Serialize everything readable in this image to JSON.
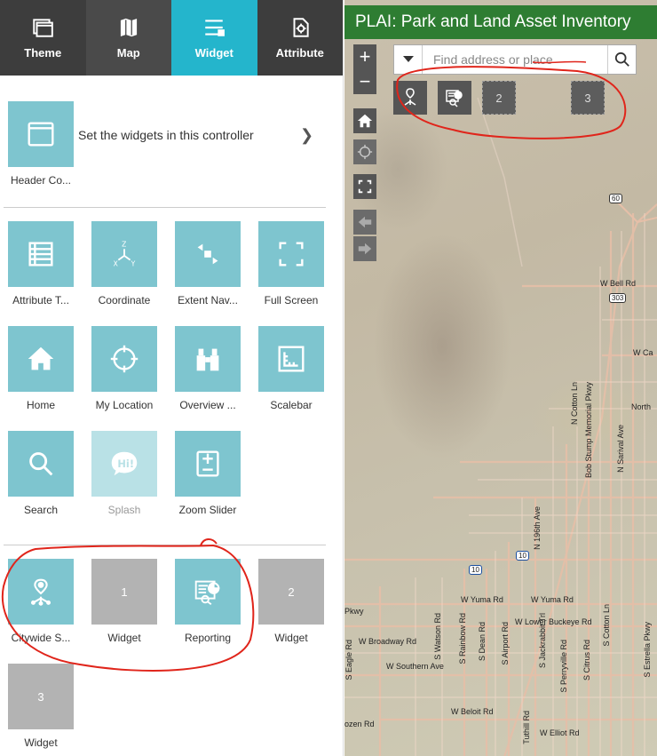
{
  "tabs": [
    {
      "label": "Theme",
      "icon": "theme-icon"
    },
    {
      "label": "Map",
      "icon": "map-icon"
    },
    {
      "label": "Widget",
      "icon": "widget-icon",
      "active": true
    },
    {
      "label": "Attribute",
      "icon": "attribute-icon"
    }
  ],
  "header_controller": {
    "label": "Header Co...",
    "description": "Set the widgets in this controller",
    "icon": "header-window-icon"
  },
  "widgets": [
    {
      "label": "Attribute T...",
      "icon": "table-icon"
    },
    {
      "label": "Coordinate",
      "icon": "xyz-axes-icon"
    },
    {
      "label": "Extent Nav...",
      "icon": "extent-arrows-icon"
    },
    {
      "label": "Full Screen",
      "icon": "fullscreen-icon"
    },
    {
      "label": "Home",
      "icon": "home-icon"
    },
    {
      "label": "My Location",
      "icon": "crosshair-icon"
    },
    {
      "label": "Overview ...",
      "icon": "binoculars-icon"
    },
    {
      "label": "Scalebar",
      "icon": "scalebar-icon"
    },
    {
      "label": "Search",
      "icon": "magnifier-icon"
    },
    {
      "label": "Splash",
      "icon": "hi-bubble-icon",
      "faded": true
    },
    {
      "label": "Zoom Slider",
      "icon": "zoom-slider-icon"
    }
  ],
  "placeholder_widgets": [
    {
      "label": "Citywide S...",
      "icon": "network-pin-icon"
    },
    {
      "label": "Widget",
      "number": "1"
    },
    {
      "label": "Reporting",
      "icon": "report-icon"
    },
    {
      "label": "Widget",
      "number": "2"
    },
    {
      "label": "Widget",
      "number": "3"
    }
  ],
  "map": {
    "title": "PLAI: Park and Land Asset Inventory",
    "search_placeholder": "Find address or place",
    "zoom_in": "+",
    "zoom_out": "−",
    "onmap_placeholders": [
      "2",
      "3"
    ],
    "labels": {
      "bell": "W Bell Rd",
      "ca": "W Ca",
      "north": "North",
      "yuma1": "W Yuma Rd",
      "yuma2": "W Yuma Rd",
      "lower_buckeye": "W Lower Buckeye Rd",
      "broadway": "W Broadway Rd",
      "southern": "W Southern Ave",
      "beloit": "W Beloit Rd",
      "elliot": "W Elliot Rd",
      "pkwy": "Pkwy",
      "ozen": "ozen Rd",
      "cotton": "N Cotton Ln",
      "bob_stump": "Bob Stump Memorial Pkwy",
      "sarival": "N Sarival Ave",
      "n_196th": "N 196th Ave",
      "cotton_s": "S Cotton Ln",
      "estrella": "S Estrella Pkwy",
      "watson": "S Watson Rd",
      "dean": "S Dean Rd",
      "airport": "S Airport Rd",
      "rainbow": "S Rainbow Rd",
      "jackrabbit": "S Jackrabbit Trl",
      "perryville": "S Perryville Rd",
      "citrus": "S Citrus Rd",
      "tuthill": "Tuthill Rd",
      "eagle": "S Eagle Rd",
      "hwy60": "60",
      "hwy303": "303",
      "i10a": "10",
      "i10b": "10"
    }
  },
  "colors": {
    "tab_active": "#24b5cc",
    "tile": "#7ec5cf",
    "title_bar": "#2e7d32",
    "annotation": "#e0251b"
  }
}
